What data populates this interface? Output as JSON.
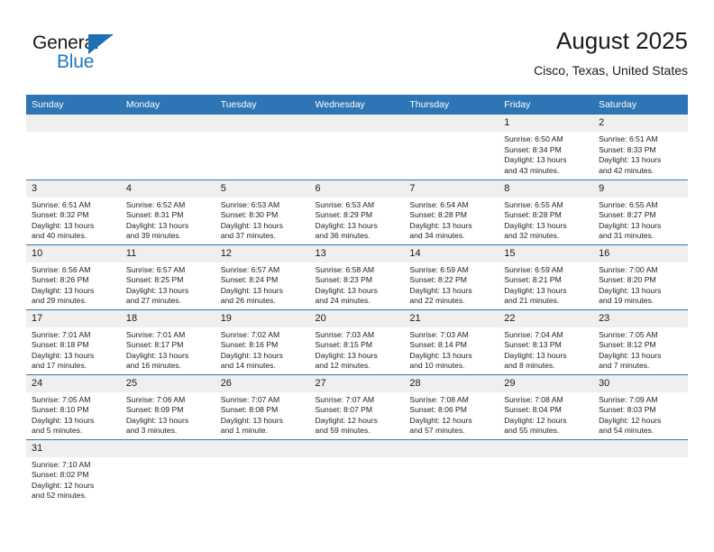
{
  "brand": {
    "word_top": "General",
    "word_bottom": "Blue",
    "triangle_icon": "triangle-logo-icon",
    "accent_color": "#1f78c1"
  },
  "header": {
    "title": "August 2025",
    "subtitle": "Cisco, Texas, United States"
  },
  "theme": {
    "header_blue": "#2e75b6",
    "daynum_gray": "#efefef",
    "text": "#1a1a1a"
  },
  "weekdays": [
    "Sunday",
    "Monday",
    "Tuesday",
    "Wednesday",
    "Thursday",
    "Friday",
    "Saturday"
  ],
  "weeks": [
    [
      {
        "day": "",
        "blank": true
      },
      {
        "day": "",
        "blank": true
      },
      {
        "day": "",
        "blank": true
      },
      {
        "day": "",
        "blank": true
      },
      {
        "day": "",
        "blank": true
      },
      {
        "day": "1",
        "sunrise": "Sunrise: 6:50 AM",
        "sunset": "Sunset: 8:34 PM",
        "daylight1": "Daylight: 13 hours",
        "daylight2": "and 43 minutes."
      },
      {
        "day": "2",
        "sunrise": "Sunrise: 6:51 AM",
        "sunset": "Sunset: 8:33 PM",
        "daylight1": "Daylight: 13 hours",
        "daylight2": "and 42 minutes."
      }
    ],
    [
      {
        "day": "3",
        "sunrise": "Sunrise: 6:51 AM",
        "sunset": "Sunset: 8:32 PM",
        "daylight1": "Daylight: 13 hours",
        "daylight2": "and 40 minutes."
      },
      {
        "day": "4",
        "sunrise": "Sunrise: 6:52 AM",
        "sunset": "Sunset: 8:31 PM",
        "daylight1": "Daylight: 13 hours",
        "daylight2": "and 39 minutes."
      },
      {
        "day": "5",
        "sunrise": "Sunrise: 6:53 AM",
        "sunset": "Sunset: 8:30 PM",
        "daylight1": "Daylight: 13 hours",
        "daylight2": "and 37 minutes."
      },
      {
        "day": "6",
        "sunrise": "Sunrise: 6:53 AM",
        "sunset": "Sunset: 8:29 PM",
        "daylight1": "Daylight: 13 hours",
        "daylight2": "and 36 minutes."
      },
      {
        "day": "7",
        "sunrise": "Sunrise: 6:54 AM",
        "sunset": "Sunset: 8:28 PM",
        "daylight1": "Daylight: 13 hours",
        "daylight2": "and 34 minutes."
      },
      {
        "day": "8",
        "sunrise": "Sunrise: 6:55 AM",
        "sunset": "Sunset: 8:28 PM",
        "daylight1": "Daylight: 13 hours",
        "daylight2": "and 32 minutes."
      },
      {
        "day": "9",
        "sunrise": "Sunrise: 6:55 AM",
        "sunset": "Sunset: 8:27 PM",
        "daylight1": "Daylight: 13 hours",
        "daylight2": "and 31 minutes."
      }
    ],
    [
      {
        "day": "10",
        "sunrise": "Sunrise: 6:56 AM",
        "sunset": "Sunset: 8:26 PM",
        "daylight1": "Daylight: 13 hours",
        "daylight2": "and 29 minutes."
      },
      {
        "day": "11",
        "sunrise": "Sunrise: 6:57 AM",
        "sunset": "Sunset: 8:25 PM",
        "daylight1": "Daylight: 13 hours",
        "daylight2": "and 27 minutes."
      },
      {
        "day": "12",
        "sunrise": "Sunrise: 6:57 AM",
        "sunset": "Sunset: 8:24 PM",
        "daylight1": "Daylight: 13 hours",
        "daylight2": "and 26 minutes."
      },
      {
        "day": "13",
        "sunrise": "Sunrise: 6:58 AM",
        "sunset": "Sunset: 8:23 PM",
        "daylight1": "Daylight: 13 hours",
        "daylight2": "and 24 minutes."
      },
      {
        "day": "14",
        "sunrise": "Sunrise: 6:59 AM",
        "sunset": "Sunset: 8:22 PM",
        "daylight1": "Daylight: 13 hours",
        "daylight2": "and 22 minutes."
      },
      {
        "day": "15",
        "sunrise": "Sunrise: 6:59 AM",
        "sunset": "Sunset: 8:21 PM",
        "daylight1": "Daylight: 13 hours",
        "daylight2": "and 21 minutes."
      },
      {
        "day": "16",
        "sunrise": "Sunrise: 7:00 AM",
        "sunset": "Sunset: 8:20 PM",
        "daylight1": "Daylight: 13 hours",
        "daylight2": "and 19 minutes."
      }
    ],
    [
      {
        "day": "17",
        "sunrise": "Sunrise: 7:01 AM",
        "sunset": "Sunset: 8:18 PM",
        "daylight1": "Daylight: 13 hours",
        "daylight2": "and 17 minutes."
      },
      {
        "day": "18",
        "sunrise": "Sunrise: 7:01 AM",
        "sunset": "Sunset: 8:17 PM",
        "daylight1": "Daylight: 13 hours",
        "daylight2": "and 16 minutes."
      },
      {
        "day": "19",
        "sunrise": "Sunrise: 7:02 AM",
        "sunset": "Sunset: 8:16 PM",
        "daylight1": "Daylight: 13 hours",
        "daylight2": "and 14 minutes."
      },
      {
        "day": "20",
        "sunrise": "Sunrise: 7:03 AM",
        "sunset": "Sunset: 8:15 PM",
        "daylight1": "Daylight: 13 hours",
        "daylight2": "and 12 minutes."
      },
      {
        "day": "21",
        "sunrise": "Sunrise: 7:03 AM",
        "sunset": "Sunset: 8:14 PM",
        "daylight1": "Daylight: 13 hours",
        "daylight2": "and 10 minutes."
      },
      {
        "day": "22",
        "sunrise": "Sunrise: 7:04 AM",
        "sunset": "Sunset: 8:13 PM",
        "daylight1": "Daylight: 13 hours",
        "daylight2": "and 8 minutes."
      },
      {
        "day": "23",
        "sunrise": "Sunrise: 7:05 AM",
        "sunset": "Sunset: 8:12 PM",
        "daylight1": "Daylight: 13 hours",
        "daylight2": "and 7 minutes."
      }
    ],
    [
      {
        "day": "24",
        "sunrise": "Sunrise: 7:05 AM",
        "sunset": "Sunset: 8:10 PM",
        "daylight1": "Daylight: 13 hours",
        "daylight2": "and 5 minutes."
      },
      {
        "day": "25",
        "sunrise": "Sunrise: 7:06 AM",
        "sunset": "Sunset: 8:09 PM",
        "daylight1": "Daylight: 13 hours",
        "daylight2": "and 3 minutes."
      },
      {
        "day": "26",
        "sunrise": "Sunrise: 7:07 AM",
        "sunset": "Sunset: 8:08 PM",
        "daylight1": "Daylight: 13 hours",
        "daylight2": "and 1 minute."
      },
      {
        "day": "27",
        "sunrise": "Sunrise: 7:07 AM",
        "sunset": "Sunset: 8:07 PM",
        "daylight1": "Daylight: 12 hours",
        "daylight2": "and 59 minutes."
      },
      {
        "day": "28",
        "sunrise": "Sunrise: 7:08 AM",
        "sunset": "Sunset: 8:06 PM",
        "daylight1": "Daylight: 12 hours",
        "daylight2": "and 57 minutes."
      },
      {
        "day": "29",
        "sunrise": "Sunrise: 7:08 AM",
        "sunset": "Sunset: 8:04 PM",
        "daylight1": "Daylight: 12 hours",
        "daylight2": "and 55 minutes."
      },
      {
        "day": "30",
        "sunrise": "Sunrise: 7:09 AM",
        "sunset": "Sunset: 8:03 PM",
        "daylight1": "Daylight: 12 hours",
        "daylight2": "and 54 minutes."
      }
    ],
    [
      {
        "day": "31",
        "sunrise": "Sunrise: 7:10 AM",
        "sunset": "Sunset: 8:02 PM",
        "daylight1": "Daylight: 12 hours",
        "daylight2": "and 52 minutes."
      },
      {
        "day": "",
        "blank": true
      },
      {
        "day": "",
        "blank": true
      },
      {
        "day": "",
        "blank": true
      },
      {
        "day": "",
        "blank": true
      },
      {
        "day": "",
        "blank": true
      },
      {
        "day": "",
        "blank": true
      }
    ]
  ]
}
